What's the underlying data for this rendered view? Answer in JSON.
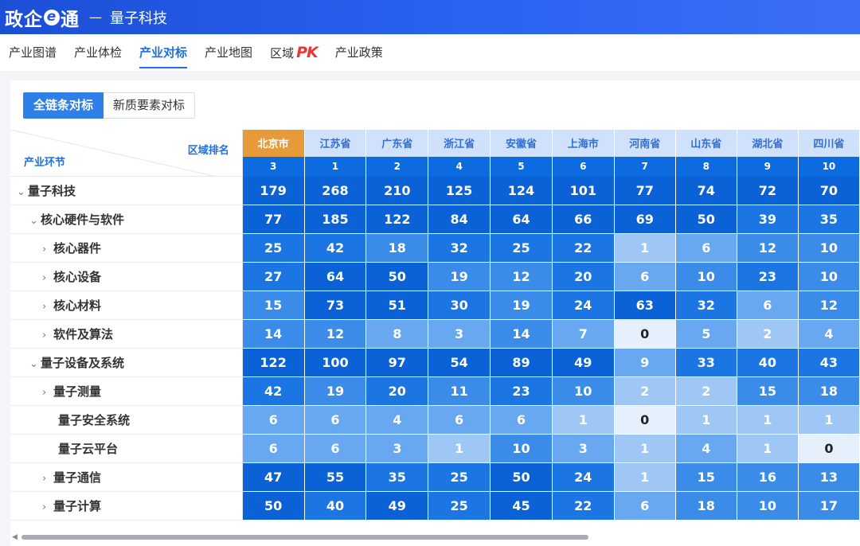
{
  "header": {
    "logo_prefix": "政企",
    "logo_e": "e",
    "logo_suffix": "通",
    "separator": "—",
    "subtitle": "量子科技"
  },
  "nav": {
    "items": [
      "产业图谱",
      "产业体检",
      "产业对标",
      "产业地图",
      "区域",
      "产业政策"
    ],
    "active_index": 2,
    "pk_badge": {
      "p": "P",
      "k": "K"
    }
  },
  "toggle": {
    "active_label": "全链条对标",
    "other_label": "新质要素对标"
  },
  "table": {
    "corner_rank_label": "区域排名",
    "corner_chain_label": "产业环节",
    "regions": [
      {
        "name": "北京市",
        "rank": "3"
      },
      {
        "name": "江苏省",
        "rank": "1"
      },
      {
        "name": "广东省",
        "rank": "2"
      },
      {
        "name": "浙江省",
        "rank": "4"
      },
      {
        "name": "安徽省",
        "rank": "5"
      },
      {
        "name": "上海市",
        "rank": "6"
      },
      {
        "name": "河南省",
        "rank": "7"
      },
      {
        "name": "山东省",
        "rank": "8"
      },
      {
        "name": "湖北省",
        "rank": "9"
      },
      {
        "name": "四川省",
        "rank": "10"
      }
    ],
    "rows": [
      {
        "label": "量子科技",
        "level": 0,
        "caret": "⌄",
        "values": [
          179,
          268,
          210,
          125,
          124,
          101,
          77,
          74,
          72,
          70
        ]
      },
      {
        "label": "核心硬件与软件",
        "level": 1,
        "caret": "⌄",
        "values": [
          77,
          185,
          122,
          84,
          64,
          66,
          69,
          50,
          39,
          35
        ]
      },
      {
        "label": "核心器件",
        "level": 2,
        "caret": "›",
        "values": [
          25,
          42,
          18,
          32,
          25,
          22,
          1,
          6,
          12,
          10
        ]
      },
      {
        "label": "核心设备",
        "level": 2,
        "caret": "›",
        "values": [
          27,
          64,
          50,
          19,
          12,
          20,
          6,
          10,
          23,
          10
        ]
      },
      {
        "label": "核心材料",
        "level": 2,
        "caret": "›",
        "values": [
          15,
          73,
          51,
          30,
          19,
          24,
          63,
          32,
          6,
          12
        ]
      },
      {
        "label": "软件及算法",
        "level": 2,
        "caret": "›",
        "values": [
          14,
          12,
          8,
          3,
          14,
          7,
          0,
          5,
          2,
          4
        ]
      },
      {
        "label": "量子设备及系统",
        "level": 1,
        "caret": "⌄",
        "values": [
          122,
          100,
          97,
          54,
          89,
          49,
          9,
          33,
          40,
          43
        ]
      },
      {
        "label": "量子测量",
        "level": 2,
        "caret": "›",
        "values": [
          42,
          19,
          20,
          11,
          23,
          10,
          2,
          2,
          15,
          18
        ]
      },
      {
        "label": "量子安全系统",
        "level": 2,
        "caret": "",
        "values": [
          6,
          6,
          4,
          6,
          6,
          1,
          0,
          1,
          1,
          1
        ]
      },
      {
        "label": "量子云平台",
        "level": 2,
        "caret": "",
        "values": [
          6,
          6,
          3,
          1,
          10,
          3,
          1,
          4,
          1,
          0
        ]
      },
      {
        "label": "量子通信",
        "level": 2,
        "caret": "›",
        "values": [
          47,
          55,
          35,
          25,
          50,
          24,
          1,
          15,
          16,
          13
        ]
      },
      {
        "label": "量子计算",
        "level": 2,
        "caret": "›",
        "values": [
          50,
          40,
          49,
          25,
          45,
          22,
          6,
          18,
          10,
          17
        ]
      }
    ],
    "colors": {
      "c0": "#0a62d6",
      "c1": "#1b76e3",
      "c2": "#3b8ce9",
      "c3": "#68a8f0",
      "c4": "#9fc7f6",
      "c5": "#e6f0fd"
    }
  }
}
